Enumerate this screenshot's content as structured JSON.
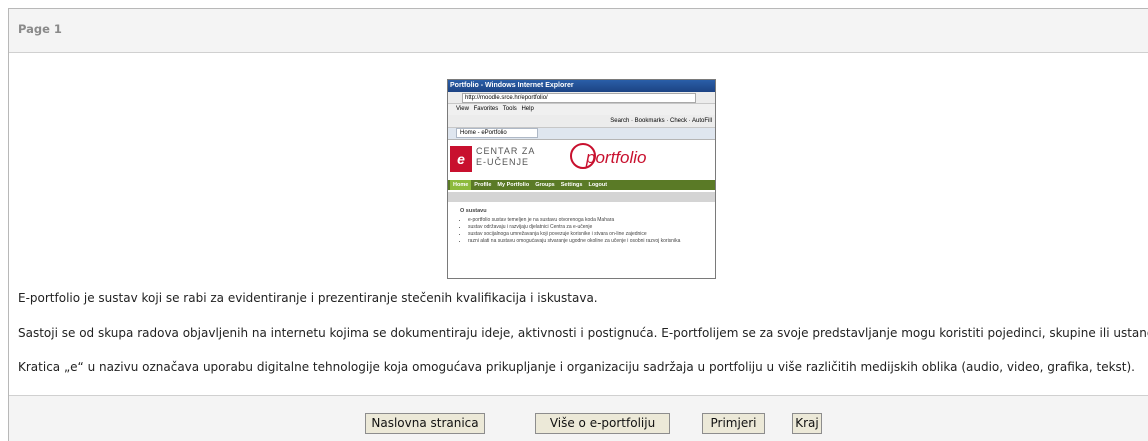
{
  "page": {
    "title": "Page 1"
  },
  "screenshot": {
    "window_title": "Portfolio - Windows Internet Explorer",
    "url": "http://moodle.srce.hr/eportfolio/",
    "menu": "View   Favorites   Tools   Help",
    "toolbar": "Search  ·  Bookmarks  ·  Check  ·  AutoFill",
    "tab": "Home - ePortfolio",
    "logo_mark": "e",
    "logo_text_line1": "CENTAR ZA",
    "logo_text_line2": "E-UČENJE",
    "portfolio_word": "portfolio",
    "nav": [
      "Home",
      "Profile",
      "My Portfolio",
      "Groups",
      "Settings",
      "Logout"
    ],
    "section_title": "O sustavu",
    "bullets": [
      "e-portfolio sustav temeljen je na sustavu otvorenoga koda Mahara",
      "sustav održavaju i razvijaju djelatnici Centra za e-učenje",
      "sustav socijalnoga umrežavanja koji povezuje korisnike i stvara on-line zajednice",
      "razni alati na sustavu omogućavaju stvaranje ugodne okoline za učenje i osobni razvoj korisnika"
    ]
  },
  "paragraphs": [
    "E-portfolio je sustav koji se rabi za evidentiranje i prezentiranje stečenih kvalifikacija i iskustava.",
    "Sastoji se od skupa radova objavljenih na internetu kojima se dokumentiraju ideje, aktivnosti i postignuća. E-portfolijem se za svoje predstavljanje mogu koristiti pojedinci, skupine ili ustanove.",
    "Kratica „e“ u nazivu označava uporabu digitalne tehnologije koja omogućava prikupljanje i organizaciju sadržaja u portfoliju u više različitih medijskih oblika (audio, video, grafika, tekst)."
  ],
  "buttons": {
    "home": "Naslovna stranica",
    "more": "Više o e-portfoliju",
    "examples": "Primjeri",
    "end": "Kraj"
  }
}
